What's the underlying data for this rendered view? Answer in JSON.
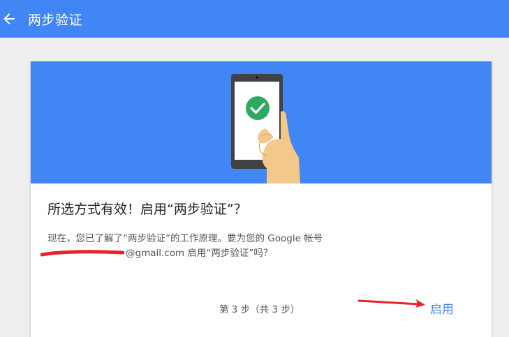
{
  "appbar": {
    "back_icon": "arrow-left-icon",
    "title": "两步验证"
  },
  "card": {
    "hero_icon": "phone-checkmark-illustration",
    "heading": "所选方式有效！启用“两步验证”？",
    "desc_line1": "现在，您已了解了“两步验证”的工作原理。要为您的 Google 帐号",
    "desc_line2": "@gmail.com 启用“两步验证”吗？",
    "step_text": "第 3 步（共 3 步）",
    "enable_label": "启用"
  },
  "colors": {
    "brand_blue": "#4285f4",
    "check_green": "#2ea962",
    "redaction_red": "#e8212a",
    "annotation_red": "#e8212a"
  }
}
